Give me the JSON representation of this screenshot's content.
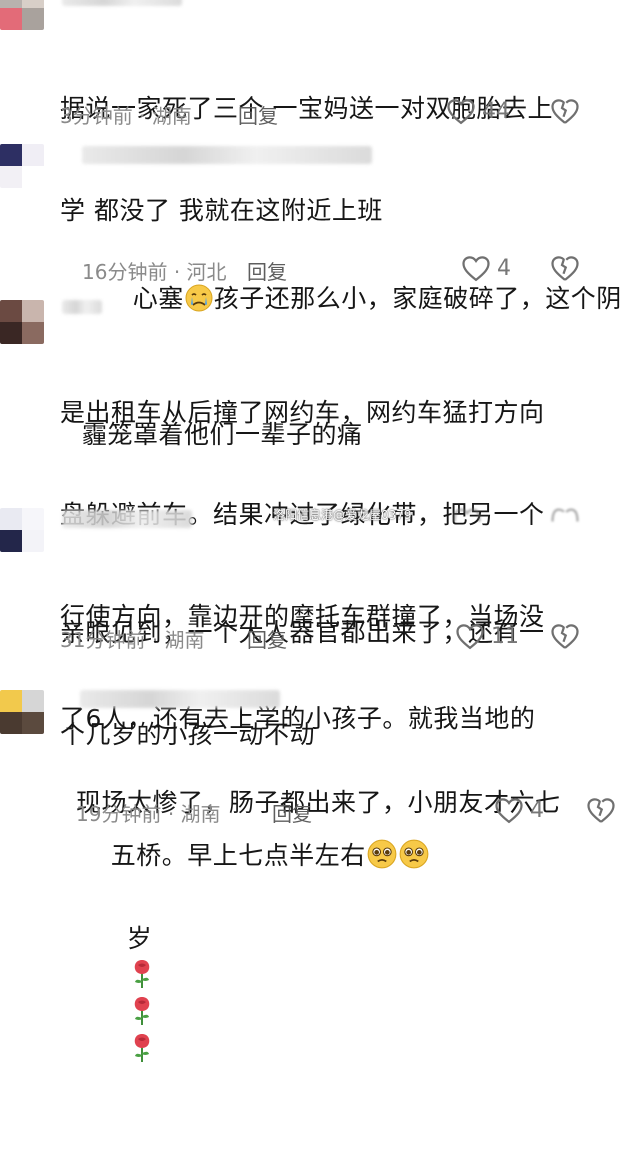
{
  "comments": [
    {
      "text_lines": [
        "据说一家死了三个 一宝妈送一对双胞胎去上",
        "学 都没了 我就在这附近上班"
      ],
      "time": "3分钟前",
      "location": "湖南",
      "reply": "回复",
      "likes": "44"
    },
    {
      "text_prefix": "心塞",
      "text_suffix": "孩子还那么小，家庭破碎了，这个阴",
      "text_line2": "霾笼罩着他们一辈子的痛",
      "time": "16分钟前",
      "location": "河北",
      "reply": "回复",
      "likes": "4"
    },
    {
      "text_lines": [
        "是出租车从后撞了网约车，网约车猛打方向",
        "盘躲避前车。结果冲过了绿化带，把另一个",
        "行使方向，靠边开的摩托车群撞了，当场没",
        "了6人，还有去上学的小孩子。就我当地的",
        "五桥。早上七点半左右"
      ]
    },
    {
      "text_lines": [
        "亲眼见到，一个大人器官都出来了，还有一",
        "个几岁的小孩一动不动"
      ],
      "time": "31分钟前",
      "location": "湖南",
      "reply": "回复",
      "likes": "11"
    },
    {
      "text_lines": [
        "现场太惨了，肠子都出来了，小朋友才六七",
        "岁"
      ],
      "time": "19分钟前",
      "location": "湖南",
      "reply": "回复",
      "likes": "4"
    }
  ],
  "watermark": "洛阳信息港@爱龙屋0379",
  "icons": {
    "like": "heart-outline-icon",
    "dislike": "broken-heart-icon",
    "sad_emoji": "crying-face-icon",
    "pleading_emoji": "pleading-face-icon",
    "rose_emoji": "rose-icon"
  },
  "colors": {
    "meta": "#8a8a8a",
    "text": "#161616",
    "icon": "#6f6f6f"
  }
}
